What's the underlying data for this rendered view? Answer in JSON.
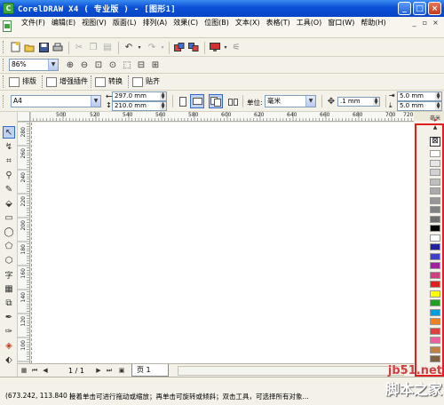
{
  "window": {
    "title": "CorelDRAW X4 ( 专业版 ) - [图形1]",
    "app_icon_letter": "C",
    "buttons": [
      "_",
      "□",
      "×"
    ]
  },
  "menubar": {
    "items": [
      "文件(F)",
      "编辑(E)",
      "视图(V)",
      "版面(L)",
      "排列(A)",
      "效果(C)",
      "位图(B)",
      "文本(X)",
      "表格(T)",
      "工具(O)",
      "窗口(W)",
      "帮助(H)"
    ],
    "right_buttons": [
      "_",
      "▫",
      "×"
    ]
  },
  "standard_toolbar": {
    "icons": [
      "new-icon",
      "open-icon",
      "save-icon",
      "print-icon",
      "cut-icon",
      "copy-icon",
      "paste-icon",
      "undo-icon",
      "redo-icon",
      "import-icon",
      "export-icon",
      "launcher-icon",
      "options-icon"
    ]
  },
  "zoom_toolbar": {
    "zoom_value": "86%"
  },
  "custom_toolbar": {
    "buttons": [
      "排版",
      "增强插件",
      "转换",
      "贴齐"
    ]
  },
  "property_bar": {
    "paper_size": "A4",
    "width": "297.0 mm",
    "height": "210.0 mm",
    "units_label": "单位:",
    "units_value": "毫米",
    "nudge_value": ".1 mm",
    "dup_x": "5.0 mm",
    "dup_y": "5.0 mm"
  },
  "ruler": {
    "top_labels": [
      "500",
      "520",
      "540",
      "560",
      "580",
      "600",
      "620",
      "640",
      "660",
      "680",
      "700",
      "720"
    ],
    "unit_text": "毫米",
    "left_labels": [
      "280",
      "260",
      "240",
      "220",
      "200",
      "180",
      "160",
      "140",
      "120",
      "100"
    ]
  },
  "pagebar": {
    "page_count": "1 / 1",
    "page_tab": "页 1"
  },
  "statusbar": {
    "coords": "(673.242, 113.840 )",
    "hint": "接着单击可进行拖动或缩放；再单击可旋转或倾斜；双击工具，可选择所有对象..."
  },
  "watermark": {
    "line1": "jb51.net",
    "line2": "脚本之家"
  },
  "palette": {
    "colors": [
      "#ffffff",
      "#e6e6e6",
      "#d2d2d2",
      "#bebebe",
      "#aaaaaa",
      "#969696",
      "#828282",
      "#6e6e6e",
      "#000000",
      "#ffffff",
      "#2020a0",
      "#4040d0",
      "#a020a0",
      "#d04080",
      "#e02020",
      "#ffff00",
      "#20a020",
      "#00a0e0",
      "#f08020",
      "#e04040",
      "#f060a0",
      "#c08040",
      "#806040"
    ]
  }
}
